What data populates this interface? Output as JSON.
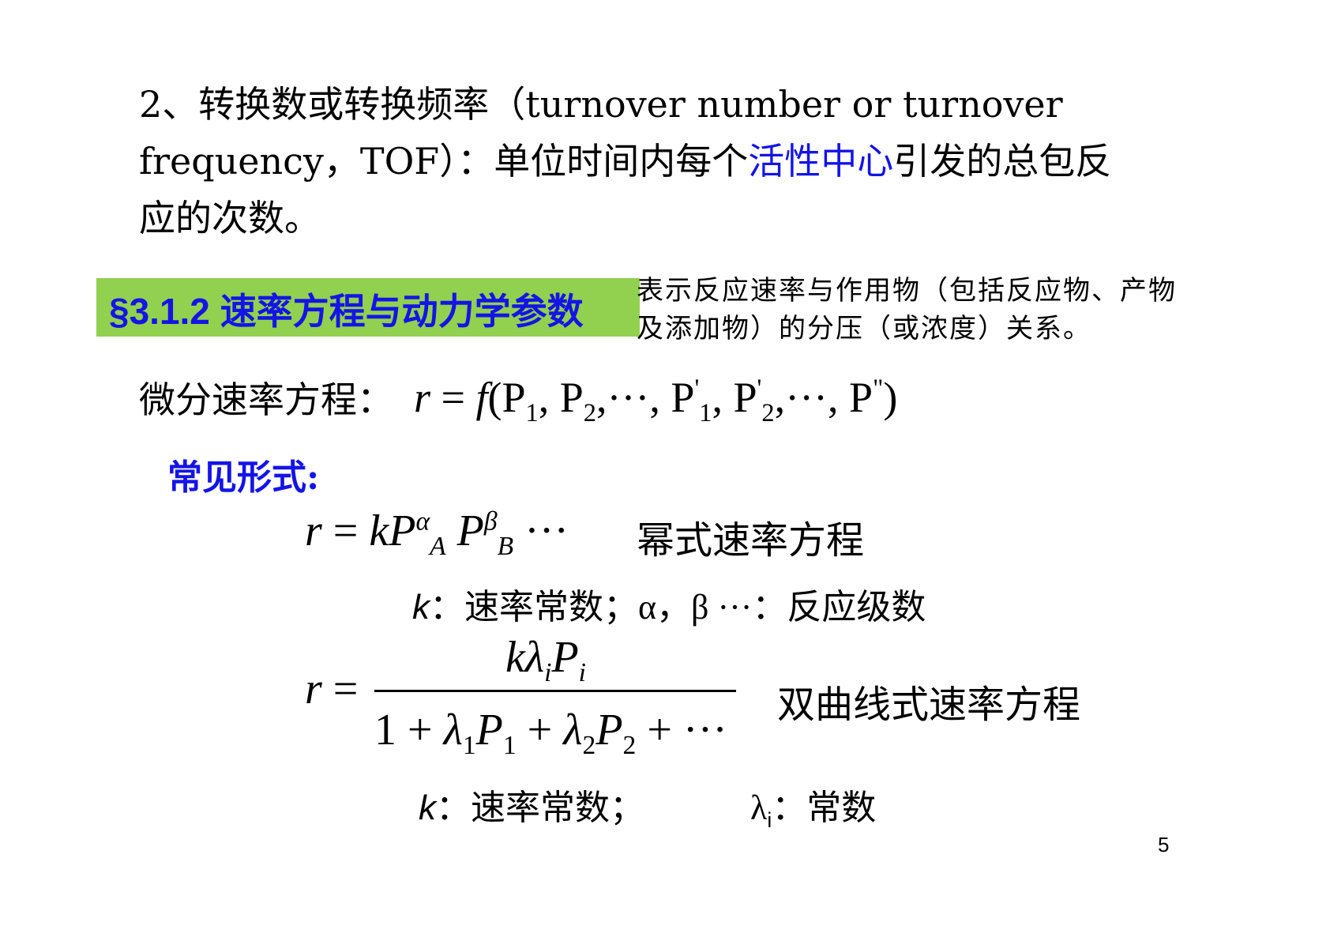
{
  "paragraph": {
    "line1": "2、转换数或转换频率（turnover number or turnover",
    "line2_a": "frequency，TOF）：单位时间内每个",
    "line2_highlight": "活性中心",
    "line2_b": "引发的总包反",
    "line3": "应的次数。"
  },
  "section": {
    "heading": "§3.1.2 速率方程与动力学参数",
    "note_line1": "表示反应速率与作用物（包括反应物、产物",
    "note_line2": "及添加物）的分压（或浓度）关系。"
  },
  "differential": {
    "label": "微分速率方程："
  },
  "common_forms": {
    "heading": "常见形式:",
    "power_law_label": "幂式速率方程",
    "power_law_desc_k": "k",
    "power_law_desc_rest": "：速率常数；",
    "power_law_desc_greek": "α，β ···",
    "power_law_desc_tail": "：反应级数",
    "hyperbolic_label": "双曲线式速率方程",
    "hyper_desc_k": "k",
    "hyper_desc_rest": "：速率常数；",
    "hyper_desc_lambda": "λ",
    "hyper_desc_lambda_sub": "i",
    "hyper_desc_tail": "：常数"
  },
  "page_number": "5",
  "colors": {
    "highlight_text": "#1414e6",
    "banner_bg": "#92d050"
  }
}
